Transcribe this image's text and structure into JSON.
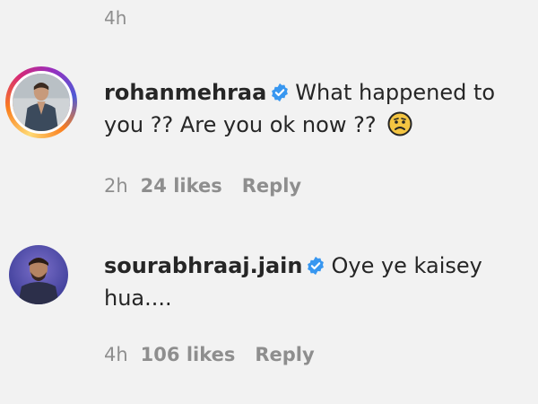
{
  "top_timestamp": "4h",
  "comments": [
    {
      "username": "rohanmehraa",
      "text_line1": "What happened to",
      "text_line2": "you ?? Are you ok now ??",
      "verified_icon": "verified-badge-icon",
      "emoji_icon": "worried-face-emoji",
      "time": "2h",
      "likes": "24 likes",
      "reply": "Reply",
      "story_ring": true
    },
    {
      "username": "sourabhraaj.jain",
      "text_line1": "Oye ye kaisey",
      "text_line2": "hua....",
      "verified_icon": "verified-badge-icon",
      "time": "4h",
      "likes": "106 likes",
      "reply": "Reply",
      "story_ring": false
    }
  ],
  "colors": {
    "background": "#f2f2f2",
    "text": "#262626",
    "secondary_text": "#8e8e8e",
    "verified_blue": "#3897f0"
  }
}
